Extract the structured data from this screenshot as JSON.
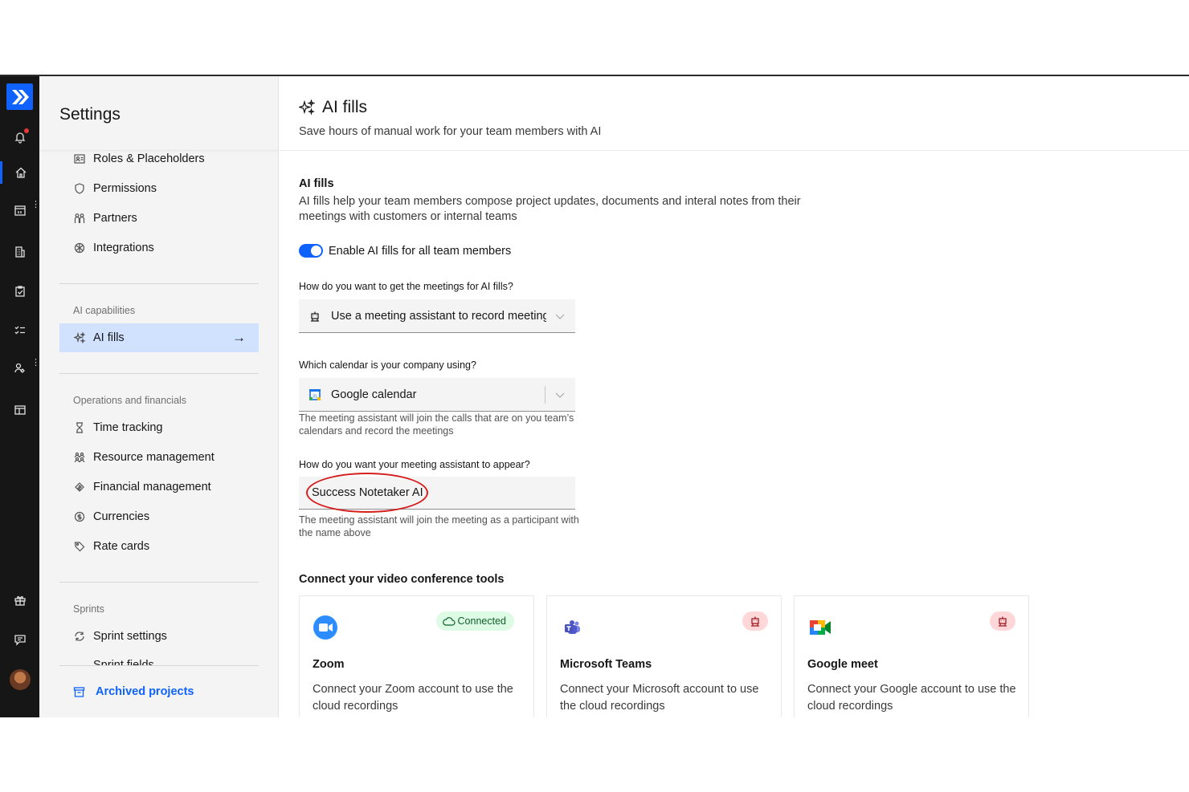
{
  "sidebar": {
    "title": "Settings",
    "items_top": [
      {
        "label": "Roles & Placeholders",
        "icon": "id-badge-icon"
      },
      {
        "label": "Permissions",
        "icon": "shield-icon"
      },
      {
        "label": "Partners",
        "icon": "partners-icon"
      },
      {
        "label": "Integrations",
        "icon": "integrations-icon"
      }
    ],
    "section_ai": "AI capabilities",
    "ai_item": {
      "label": "AI fills",
      "arrow": "→"
    },
    "section_ops": "Operations and financials",
    "items_ops": [
      {
        "label": "Time tracking",
        "icon": "hourglass-icon"
      },
      {
        "label": "Resource management",
        "icon": "people-icon"
      },
      {
        "label": "Financial management",
        "icon": "finance-icon"
      },
      {
        "label": "Currencies",
        "icon": "currency-icon"
      },
      {
        "label": "Rate cards",
        "icon": "tag-icon"
      }
    ],
    "section_sprints": "Sprints",
    "sprint_item": {
      "label": "Sprint settings"
    },
    "sprint_fields_cutoff": "Sprint fields",
    "archived": "Archived projects"
  },
  "main": {
    "title": "AI fills",
    "subtitle": "Save hours of manual work for your team members with AI",
    "section_title": "AI fills",
    "section_desc": "AI fills help your team members compose project updates, documents and interal notes from their meetings with customers or internal teams",
    "toggle": {
      "label": "Enable AI fills for all team members",
      "on": true
    },
    "q1": {
      "label": "How do you want to get the meetings for AI fills?",
      "value": "Use a meeting assistant to record meetings"
    },
    "q2": {
      "label": "Which calendar is your company using?",
      "value": "Google calendar",
      "helper": "The meeting assistant will join the calls that are on you team’s calendars and record the meetings"
    },
    "q3": {
      "label": "How do you want your meeting assistant to appear?",
      "value": "Success Notetaker AI",
      "helper": "The meeting assistant will join the meeting as a participant with the name above"
    },
    "tools_title": "Connect your video conference tools",
    "tools": [
      {
        "name": "Zoom",
        "desc": "Connect your Zoom account to use the cloud recordings",
        "status": "Connected"
      },
      {
        "name": "Microsoft Teams",
        "desc": "Connect your Microsoft account to use the cloud recordings",
        "status": ""
      },
      {
        "name": "Google meet",
        "desc": "Connect your Google account to use the cloud recordings",
        "status": ""
      }
    ]
  },
  "colors": {
    "accent": "#0f62fe",
    "rail": "#161616",
    "selected": "#d0e2ff",
    "annotation": "#d41f1f",
    "connected_bg": "#defbe6"
  }
}
